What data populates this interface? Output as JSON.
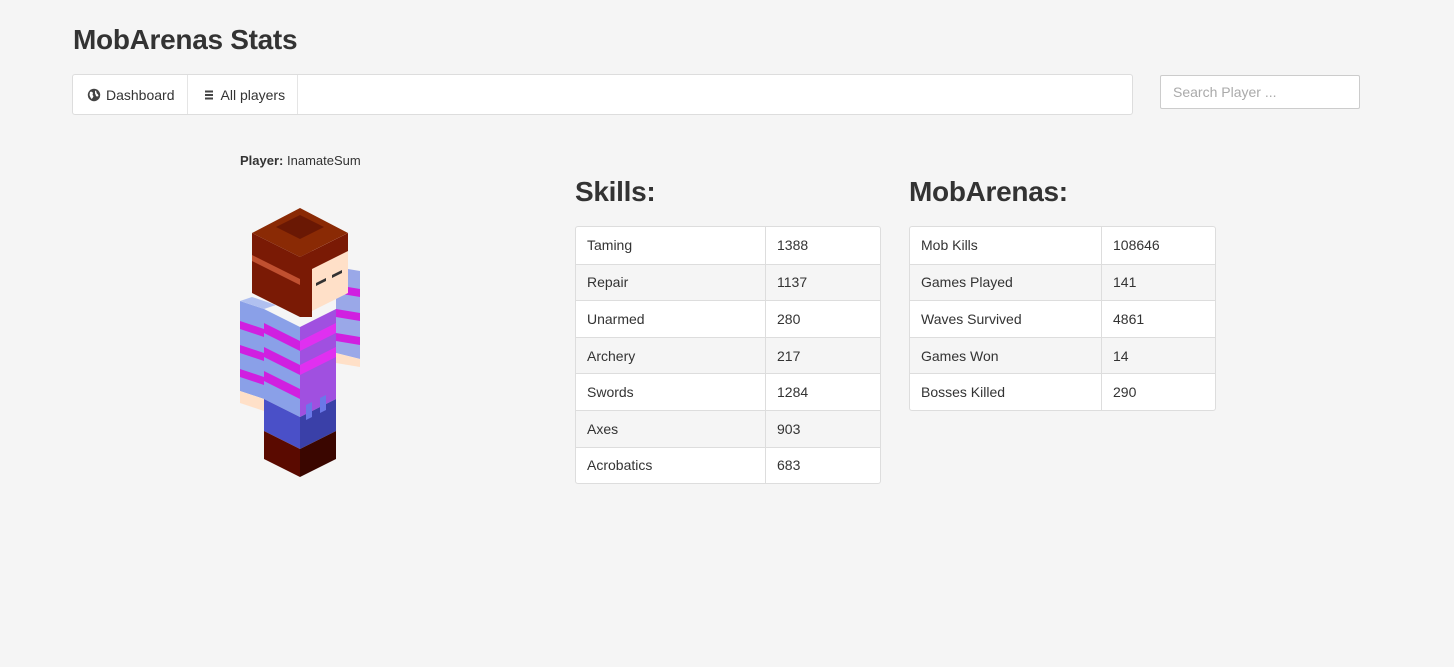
{
  "header": {
    "title": "MobArenas Stats"
  },
  "nav": {
    "items": [
      {
        "label": "Dashboard",
        "icon": "globe-icon"
      },
      {
        "label": "All players",
        "icon": "list-icon"
      }
    ]
  },
  "search": {
    "placeholder": "Search Player ..."
  },
  "player": {
    "label": "Player:",
    "name": "InamateSum"
  },
  "skills": {
    "heading": "Skills:",
    "rows": [
      {
        "name": "Taming",
        "value": "1388"
      },
      {
        "name": "Repair",
        "value": "1137"
      },
      {
        "name": "Unarmed",
        "value": "280"
      },
      {
        "name": "Archery",
        "value": "217"
      },
      {
        "name": "Swords",
        "value": "1284"
      },
      {
        "name": "Axes",
        "value": "903"
      },
      {
        "name": "Acrobatics",
        "value": "683"
      }
    ]
  },
  "mobarenas": {
    "heading": "MobArenas:",
    "rows": [
      {
        "name": "Mob Kills",
        "value": "108646"
      },
      {
        "name": "Games Played",
        "value": "141"
      },
      {
        "name": "Waves Survived",
        "value": "4861"
      },
      {
        "name": "Games Won",
        "value": "14"
      },
      {
        "name": "Bosses Killed",
        "value": "290"
      }
    ]
  },
  "colors": {
    "background": "#f5f5f5",
    "hair": "#7a1a05",
    "skin": "#ffe0c8",
    "shirt_blue": "#8aa0e8",
    "shirt_magenta": "#d020e0",
    "pants": "#4a50c8",
    "boots": "#5a0a00"
  }
}
